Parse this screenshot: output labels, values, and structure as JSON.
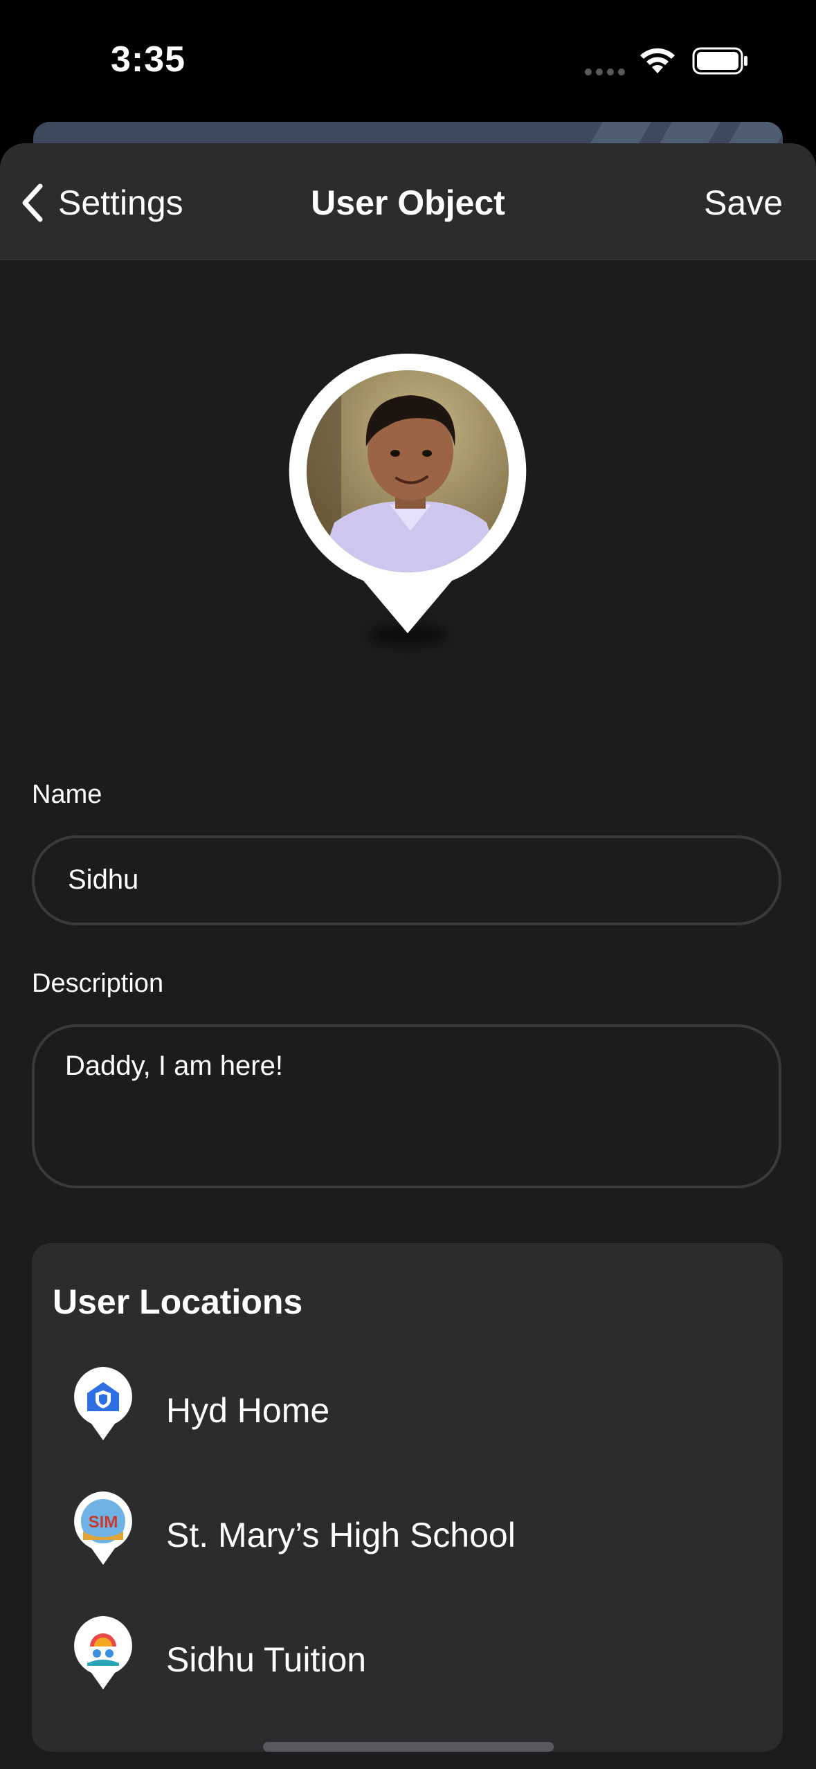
{
  "status_bar": {
    "time": "3:35"
  },
  "nav": {
    "back_label": "Settings",
    "title": "User Object",
    "save_label": "Save"
  },
  "form": {
    "name_label": "Name",
    "name_value": "Sidhu",
    "description_label": "Description",
    "description_value": "Daddy, I am here!"
  },
  "locations": {
    "title": "User Locations",
    "items": [
      {
        "label": "Hyd Home",
        "icon": "home-shield-icon"
      },
      {
        "label": "St. Mary’s High School",
        "icon": "school-logo-icon"
      },
      {
        "label": "Sidhu Tuition",
        "icon": "tuition-logo-icon"
      }
    ]
  },
  "colors": {
    "background": "#1c1c1e",
    "card": "#2c2c2e",
    "accent_blue": "#2f6fe4"
  }
}
